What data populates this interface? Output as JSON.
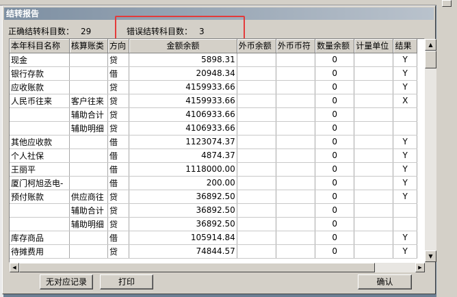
{
  "dialog": {
    "title": "结转报告"
  },
  "summary": {
    "correct_label": "正确结转科目数：",
    "correct_count": "29",
    "error_label": "错误结转科目数：",
    "error_count": "3"
  },
  "table": {
    "headers": [
      "本年科目名称",
      "核算账类",
      "方向",
      "金额余额",
      "外币余额",
      "外币币符",
      "数量余额",
      "计量单位",
      "结果"
    ],
    "rows": [
      [
        "现金",
        "",
        "贷",
        "5898.31",
        "",
        "",
        "0",
        "",
        "Y"
      ],
      [
        "银行存款",
        "",
        "借",
        "20948.34",
        "",
        "",
        "0",
        "",
        "Y"
      ],
      [
        "应收账款",
        "",
        "贷",
        "4159933.66",
        "",
        "",
        "0",
        "",
        "Y"
      ],
      [
        "人民币往来",
        "客户往来",
        "贷",
        "4159933.66",
        "",
        "",
        "0",
        "",
        "X"
      ],
      [
        "",
        "辅助合计",
        "贷",
        "4106933.66",
        "",
        "",
        "0",
        "",
        ""
      ],
      [
        "",
        "辅助明细",
        "贷",
        "4106933.66",
        "",
        "",
        "0",
        "",
        ""
      ],
      [
        "其他应收款",
        "",
        "借",
        "1123074.37",
        "",
        "",
        "0",
        "",
        "Y"
      ],
      [
        "个人社保",
        "",
        "借",
        "4874.37",
        "",
        "",
        "0",
        "",
        "Y"
      ],
      [
        "王丽平",
        "",
        "借",
        "1118000.00",
        "",
        "",
        "0",
        "",
        "Y"
      ],
      [
        "厦门柯旭丞电-",
        "",
        "借",
        "200.00",
        "",
        "",
        "0",
        "",
        "Y"
      ],
      [
        "预付账款",
        "供应商往",
        "贷",
        "36892.50",
        "",
        "",
        "0",
        "",
        "Y"
      ],
      [
        "",
        "辅助合计",
        "贷",
        "36892.50",
        "",
        "",
        "0",
        "",
        ""
      ],
      [
        "",
        "辅助明细",
        "贷",
        "36892.50",
        "",
        "",
        "0",
        "",
        ""
      ],
      [
        "库存商品",
        "",
        "借",
        "105914.84",
        "",
        "",
        "0",
        "",
        "Y"
      ],
      [
        "待摊费用",
        "",
        "贷",
        "74844.57",
        "",
        "",
        "0",
        "",
        "Y"
      ]
    ]
  },
  "buttons": {
    "no_match": "无对应记录",
    "print": "打印",
    "confirm": "确认"
  },
  "icons": {
    "scroll_up": "▲",
    "scroll_down": "▼",
    "scroll_left": "◀",
    "scroll_right": "▶"
  },
  "colors": {
    "highlight_box": "#e43a3a",
    "titlebar": "#7d8fa2"
  }
}
